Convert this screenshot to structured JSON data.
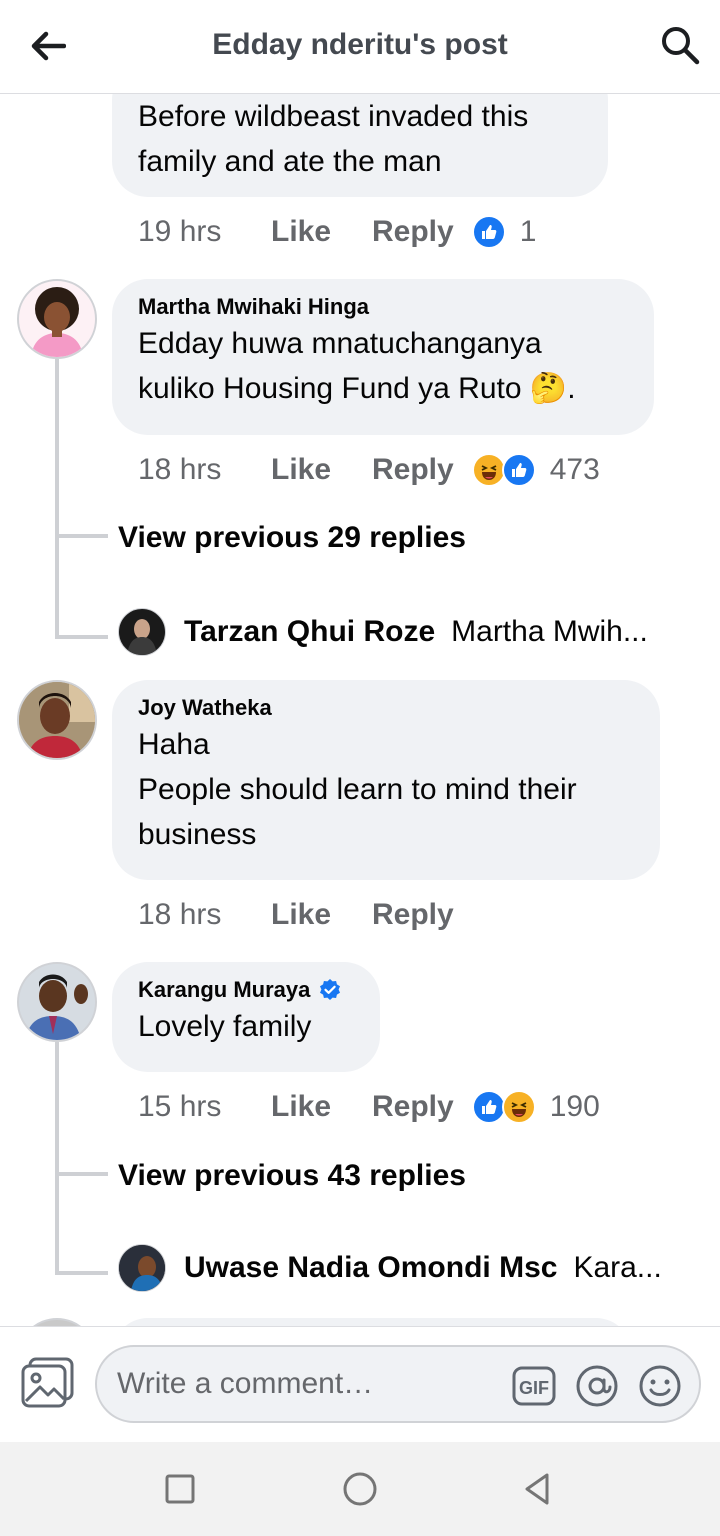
{
  "header": {
    "title": "Edday nderitu's post"
  },
  "comments": [
    {
      "text": "Before wildbeast invaded this\nfamily and ate the man",
      "time": "19 hrs",
      "like": "Like",
      "reply": "Reply",
      "reaction_count": "1"
    },
    {
      "author": "Martha Mwihaki Hinga",
      "text": "Edday huwa mnatuchanganya\nkuliko Housing Fund ya Ruto 🤔.",
      "time": "18 hrs",
      "like": "Like",
      "reply": "Reply",
      "reaction_count": "473",
      "view_replies": "View previous 29 replies",
      "latest_reply": {
        "name": "Tarzan Qhui Roze",
        "snippet": "Martha Mwih..."
      }
    },
    {
      "author": "Joy Watheka",
      "text": "Haha\nPeople should learn to mind their\nbusiness",
      "time": "18 hrs",
      "like": "Like",
      "reply": "Reply"
    },
    {
      "author": "Karangu Muraya",
      "text": "Lovely family",
      "time": "15 hrs",
      "like": "Like",
      "reply": "Reply",
      "reaction_count": "190",
      "view_replies": "View previous 43 replies",
      "latest_reply": {
        "name": "Uwase Nadia Omondi Msc",
        "snippet": "Kara..."
      }
    }
  ],
  "composer": {
    "placeholder": "Write a comment…",
    "gif_label": "GIF"
  },
  "colors": {
    "like_blue": "#1877f2",
    "bubble_bg": "#f0f2f5",
    "meta_gray": "#65676b"
  }
}
